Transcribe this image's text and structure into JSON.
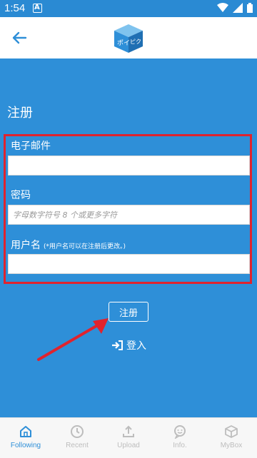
{
  "status": {
    "time": "1:54",
    "a_icon": "A"
  },
  "page_title": "注册",
  "form": {
    "email_label": "电子邮件",
    "email_value": "",
    "password_label": "密码",
    "password_placeholder": "字母数字符号 8 个或更多字符",
    "username_label": "用户名",
    "username_note": "(*用户名可以在注册后更改。)",
    "username_value": ""
  },
  "register_button": "注册",
  "login_link": "登入",
  "colors": {
    "primary": "#2e8fd8",
    "highlight": "#e0232e"
  },
  "nav": [
    {
      "label": "Following",
      "icon": "home-icon",
      "active": true
    },
    {
      "label": "Recent",
      "icon": "clock-icon",
      "active": false
    },
    {
      "label": "Upload",
      "icon": "upload-icon",
      "active": false
    },
    {
      "label": "Info.",
      "icon": "chat-icon",
      "active": false
    },
    {
      "label": "MyBox",
      "icon": "box-icon",
      "active": false
    }
  ]
}
